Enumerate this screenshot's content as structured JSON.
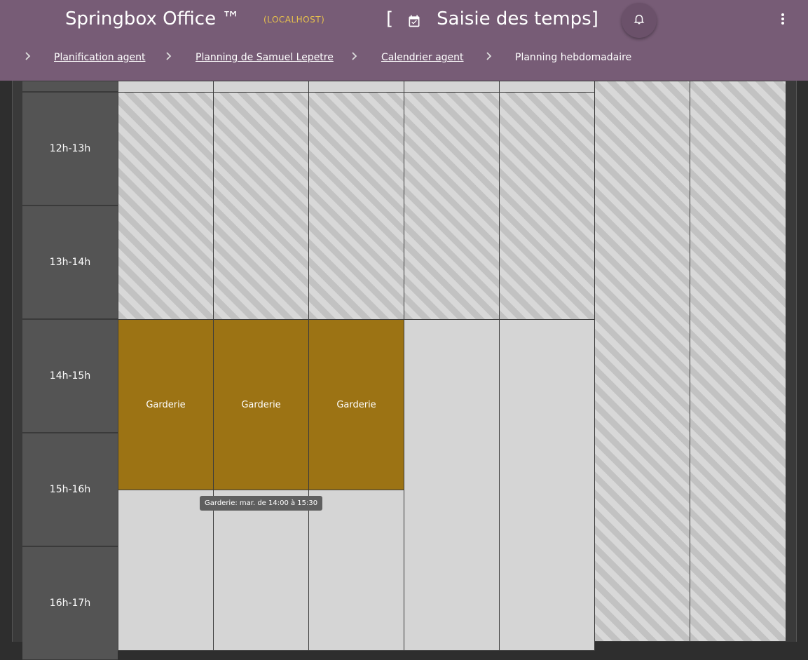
{
  "header": {
    "app_title": "Springbox Office ™",
    "env_badge": "(LOCALHOST)",
    "page_title_open": "[",
    "page_title": "Saisie des temps]",
    "page_icon": "calendar-check-icon",
    "bell_icon": "bell-icon",
    "more_icon": "more-vert-icon",
    "background": "#775c76"
  },
  "breadcrumb": [
    {
      "label": "Planification agent",
      "link": true
    },
    {
      "label": "Planning de Samuel Lepetre",
      "link": true
    },
    {
      "label": "Calendrier agent",
      "link": true
    },
    {
      "label": "Planning hebdomadaire",
      "link": false
    }
  ],
  "calendar": {
    "hours": [
      "12h-13h",
      "13h-14h",
      "14h-15h",
      "15h-16h",
      "16h-17h"
    ],
    "events": [
      {
        "label": "Garderie"
      },
      {
        "label": "Garderie"
      },
      {
        "label": "Garderie"
      }
    ],
    "tooltip": "Garderie: mar. de 14:00 à 15:30",
    "colors": {
      "event": "#9c7314",
      "free": "#d5d5d5",
      "unavailable_hatch": "#c2c2c2",
      "hour_column": "#545454"
    }
  }
}
